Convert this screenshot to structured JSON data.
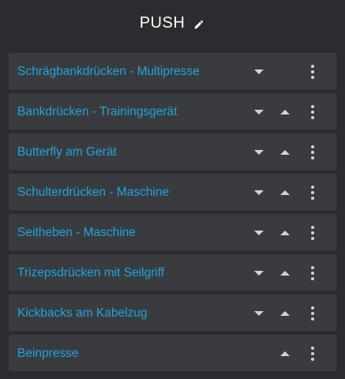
{
  "header": {
    "title": "PUSH",
    "edit_icon": "pencil-icon"
  },
  "colors": {
    "background": "#2b2c30",
    "row_background": "#3a3b3f",
    "label": "#1ea5e0",
    "icon": "#d3d4d6"
  },
  "exercises": [
    {
      "label": "Schrägbankdrücken - Multipresse",
      "move_down": true,
      "move_up": false
    },
    {
      "label": "Bankdrücken - Trainingsgerät",
      "move_down": true,
      "move_up": true
    },
    {
      "label": "Butterfly am Gerät",
      "move_down": true,
      "move_up": true
    },
    {
      "label": "Schulterdrücken - Maschine",
      "move_down": true,
      "move_up": true
    },
    {
      "label": "Seitheben - Maschine",
      "move_down": true,
      "move_up": true
    },
    {
      "label": "Trizepsdrücken mit Seilgriff",
      "move_down": true,
      "move_up": true
    },
    {
      "label": "Kickbacks am Kabelzug",
      "move_down": true,
      "move_up": true
    },
    {
      "label": "Beinpresse",
      "move_down": false,
      "move_up": true
    }
  ],
  "icons": {
    "move_down": "arrow-down-icon",
    "move_up": "arrow-up-icon",
    "menu": "more-vert-icon"
  }
}
